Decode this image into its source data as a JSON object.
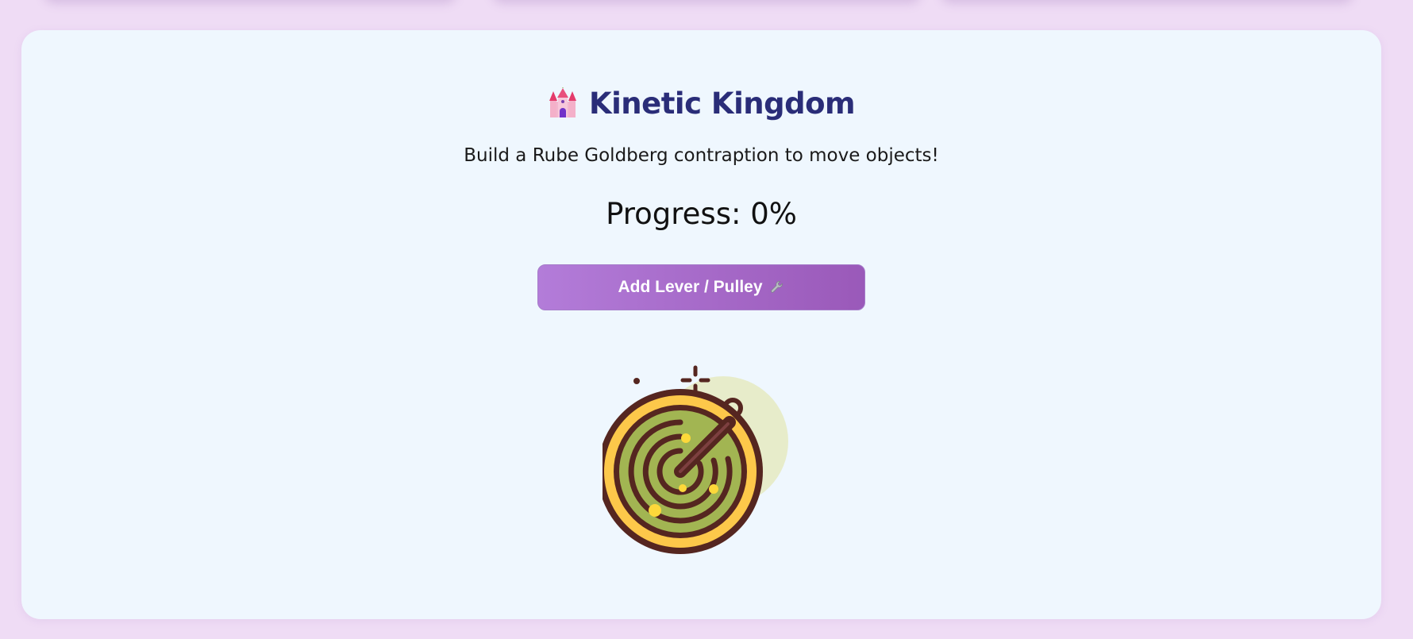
{
  "app": {
    "title": "Kinetic Kingdom",
    "title_icon": "castle-icon",
    "subtitle": "Build a Rube Goldberg contraption to move objects!",
    "progress_text": "Progress: 0%",
    "progress_value": 0
  },
  "actions": {
    "add_button_label": "Add Lever / Pulley",
    "add_button_icon": "wrench-icon"
  },
  "illustration": {
    "name": "radar-illustration"
  },
  "colors": {
    "background": "#efdcf5",
    "card": "#eff7fe",
    "title": "#2a2d78",
    "button_start": "#b37cd9",
    "button_end": "#9a59b9",
    "radar_outline": "#552620",
    "radar_yellow": "#fdc84a",
    "radar_green": "#a2b552"
  }
}
